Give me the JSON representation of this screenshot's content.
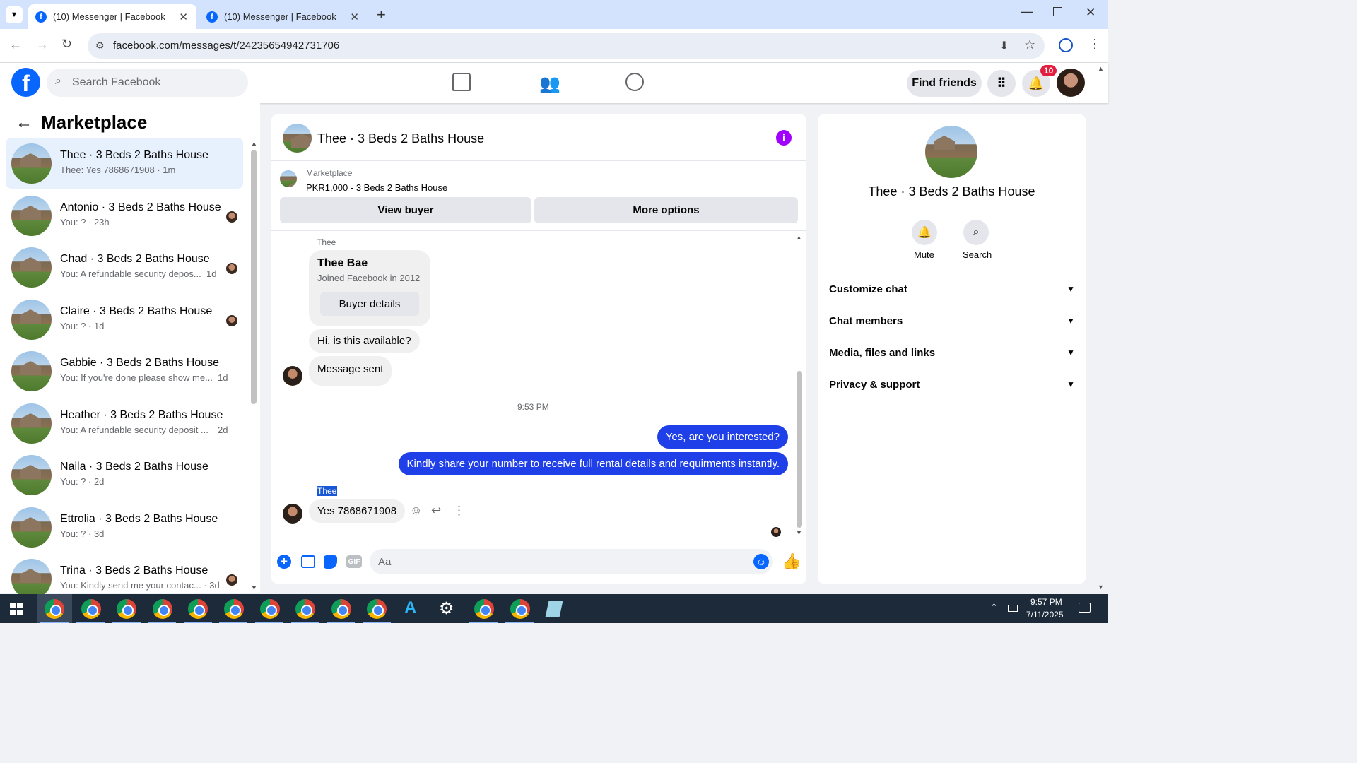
{
  "browser": {
    "tabs": [
      {
        "title": "(10) Messenger | Facebook",
        "active": true
      },
      {
        "title": "(10) Messenger | Facebook",
        "active": false
      }
    ],
    "url": "facebook.com/messages/t/24235654942731706"
  },
  "header": {
    "search_placeholder": "Search Facebook",
    "find_friends": "Find friends",
    "notification_count": "10"
  },
  "sidebar": {
    "title": "Marketplace",
    "conversations": [
      {
        "title": "Thee · 3 Beds 2 Baths House",
        "snippet": "Thee: Yes 7868671908 · 1m",
        "selected": true
      },
      {
        "title": "Antonio · 3 Beds 2 Baths House",
        "snippet": "You: ? · 23h"
      },
      {
        "title": "Chad · 3 Beds 2 Baths House",
        "snippet": "You: A refundable security depos...",
        "time": "1d"
      },
      {
        "title": "Claire · 3 Beds 2 Baths House",
        "snippet": "You: ? · 1d"
      },
      {
        "title": "Gabbie · 3 Beds 2 Baths House",
        "snippet": "You: If you're done please show me...",
        "time": "1d"
      },
      {
        "title": "Heather · 3 Beds 2 Baths House",
        "snippet": "You: A refundable security deposit ...",
        "time": "2d"
      },
      {
        "title": "Naila · 3 Beds 2 Baths House",
        "snippet": "You: ? · 2d"
      },
      {
        "title": "Ettrolia · 3 Beds 2 Baths House",
        "snippet": "You: ? · 3d"
      },
      {
        "title": "Trina · 3 Beds 2 Baths House",
        "snippet": "You: Kindly send me your contac... · 3d"
      }
    ]
  },
  "chat": {
    "title": "Thee · 3 Beds 2 Baths House",
    "listing_source": "Marketplace",
    "listing": "PKR1,000 - 3 Beds 2 Baths House",
    "view_buyer": "View buyer",
    "more_options": "More options",
    "sender_label": "Thee",
    "buyer_name": "Thee Bae",
    "buyer_joined": "Joined Facebook in 2012",
    "buyer_details": "Buyer details",
    "msg1": "Hi, is this available?",
    "msg2": "Message sent",
    "timestamp": "9:53 PM",
    "out1": "Yes, are you interested?",
    "out2": "Kindly share your number to receive full rental details and requirments instantly.",
    "sender_label2": "Thee",
    "msg3": "Yes 7868671908",
    "composer_placeholder": "Aa",
    "gif_label": "GIF"
  },
  "details": {
    "title": "Thee · 3 Beds 2 Baths House",
    "mute": "Mute",
    "search": "Search",
    "sections": [
      "Customize chat",
      "Chat members",
      "Media, files and links",
      "Privacy & support"
    ]
  },
  "taskbar": {
    "time": "9:57 PM",
    "date": "7/11/2025"
  },
  "colors": {
    "accent": "#0866ff",
    "outgoing_bubble": "#1f3fe8",
    "info_icon": "#a100ff"
  }
}
